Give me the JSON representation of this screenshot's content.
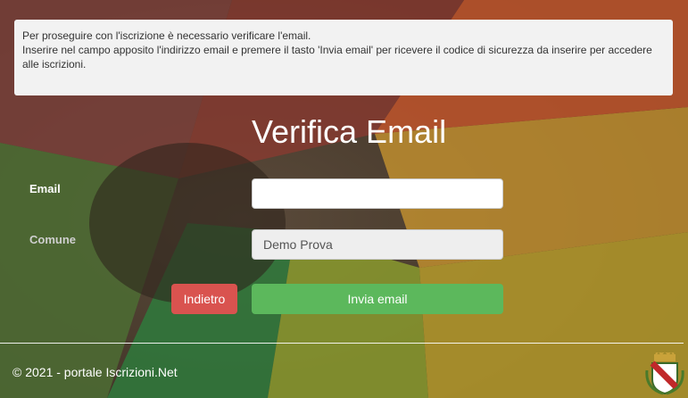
{
  "notice": {
    "line1": "Per proseguire con l'iscrizione è necessario verificare l'email.",
    "line2": "Inserire nel campo apposito l'indirizzo email e premere il tasto 'Invia email' per ricevere il codice di sicurezza da inserire per accedere alle iscrizioni."
  },
  "form": {
    "title": "Verifica Email",
    "email_label": "Email",
    "email_value": "",
    "comune_label": "Comune",
    "comune_value": "Demo Prova",
    "back_label": "Indietro",
    "send_label": "Invia email"
  },
  "footer": {
    "copyright": "© 2021 - portale Iscrizioni.Net",
    "crest_icon": "coat-of-arms-icon"
  },
  "colors": {
    "danger": "#d9534f",
    "success": "#5cb85c"
  }
}
